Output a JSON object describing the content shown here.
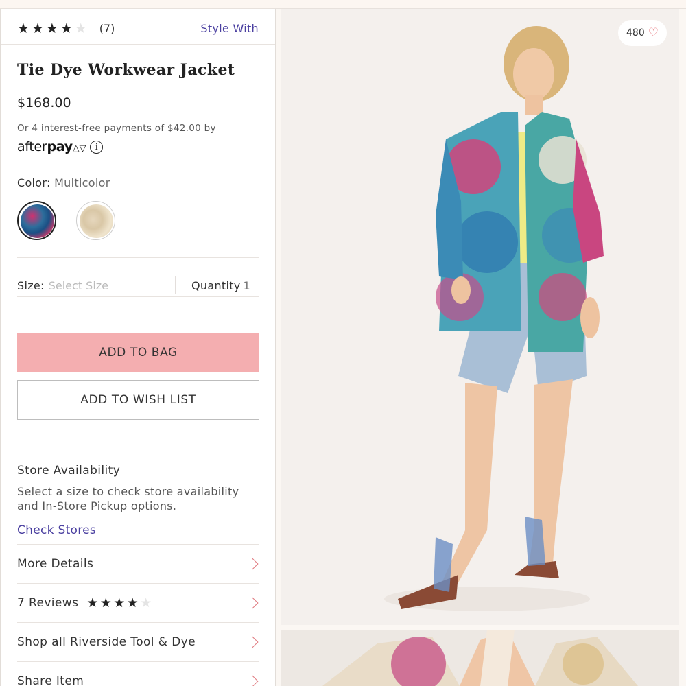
{
  "rating": {
    "stars_filled": 4,
    "stars_total": 5,
    "count": "(7)"
  },
  "style_with": "Style With",
  "product": {
    "title": "Tie Dye Workwear Jacket",
    "price": "$168.00",
    "afterpay_text": "Or 4 interest-free payments of $42.00 by",
    "afterpay_logo_light": "after",
    "afterpay_logo_bold": "pay",
    "afterpay_mark": "△▽",
    "info_glyph": "i"
  },
  "color": {
    "label": "Color:",
    "value": "Multicolor"
  },
  "size": {
    "label": "Size:",
    "placeholder": "Select Size"
  },
  "quantity": {
    "label": "Quantity",
    "value": "1"
  },
  "buttons": {
    "add_to_bag": "ADD TO BAG",
    "add_to_wish_list": "ADD TO WISH LIST",
    "add_to_bag_color": "#f4aeb0"
  },
  "store": {
    "title": "Store Availability",
    "description": "Select a size to check store availability and In-Store Pickup options.",
    "check_stores": "Check Stores"
  },
  "links": {
    "more_details": "More Details",
    "reviews": "7 Reviews",
    "shop_all": "Shop all Riverside Tool & Dye",
    "share": "Share Item"
  },
  "photo": {
    "likes": "480"
  },
  "colors": {
    "accent_link": "#4a3fa0",
    "chevron": "#e07a7f",
    "heart": "#e56a72"
  }
}
